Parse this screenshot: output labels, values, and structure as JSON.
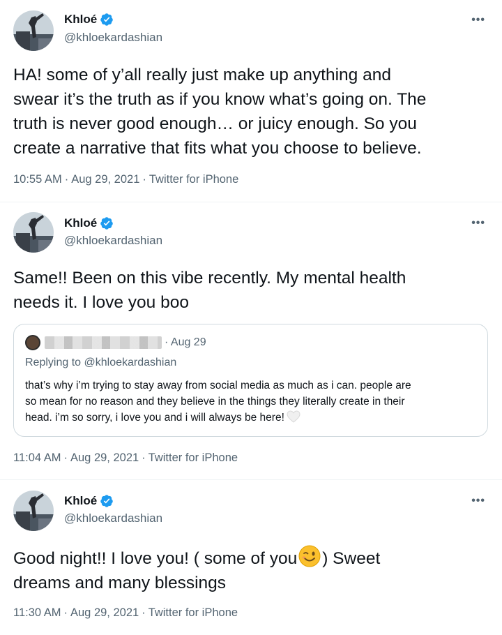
{
  "tweets": [
    {
      "name": "Khloé",
      "handle": "@khloekardashian",
      "more_label": "•••",
      "text_lines": [
        "HA! some of y’all really just make up anything and",
        "swear it’s the truth as if you know what’s going on. The",
        "truth is never good enough… or juicy enough. So you",
        "create a narrative that fits what you choose to believe."
      ],
      "time": "10:55 AM",
      "date": "Aug 29, 2021",
      "source": "Twitter for iPhone"
    },
    {
      "name": "Khloé",
      "handle": "@khloekardashian",
      "more_label": "•••",
      "text_lines": [
        "Same!! Been on this vibe recently. My mental health",
        "needs it. I love you boo"
      ],
      "quote": {
        "date": "· Aug 29",
        "replying_to": "Replying to @khloekardashian",
        "text_lines": [
          "that’s why i’m trying to stay away from social media as much as i can. people are",
          "so mean for no reason and they believe in the things they literally create in their",
          "head. i’m so sorry, i love you and i will always be here!"
        ]
      },
      "time": "11:04 AM",
      "date": "Aug 29, 2021",
      "source": "Twitter for iPhone"
    },
    {
      "name": "Khloé",
      "handle": "@khloekardashian",
      "more_label": "•••",
      "text_line1_before": "Good night!! I love you! ( some of you",
      "text_line1_after": ") Sweet",
      "text_line2": "dreams and many blessings",
      "time": "11:30 AM",
      "date": "Aug 29, 2021",
      "source": "Twitter for iPhone"
    }
  ],
  "separator": "·",
  "icons": {
    "verified": "verified-badge-icon",
    "more": "more-options-icon",
    "wink": "winking-face-emoji",
    "heart": "white-heart-emoji"
  },
  "colors": {
    "verified": "#1d9bf0",
    "secondary_text": "#536471",
    "border": "#cfd9de"
  }
}
